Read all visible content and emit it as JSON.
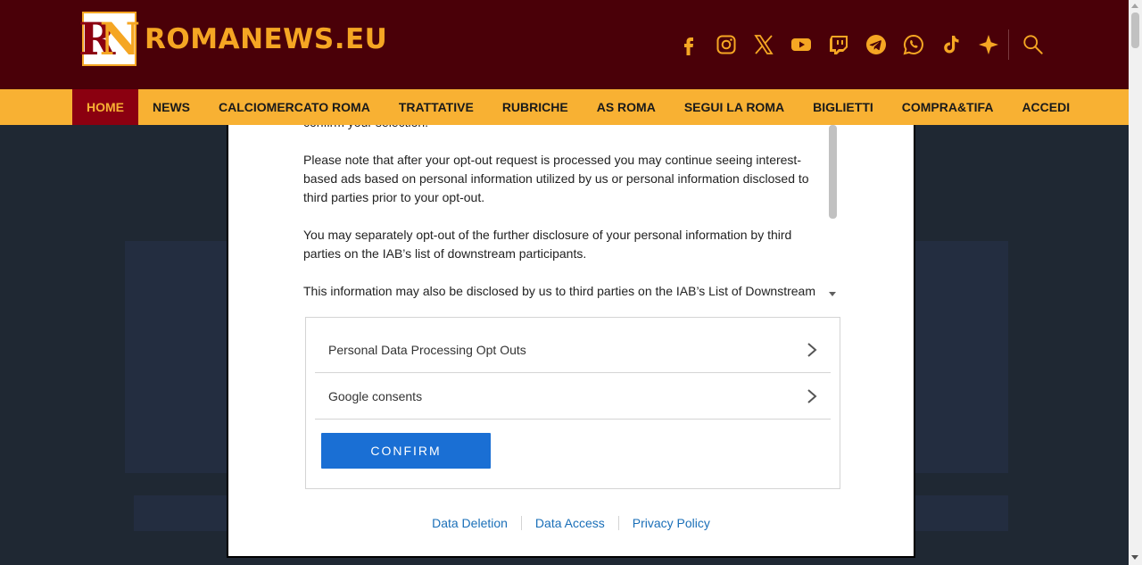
{
  "site": {
    "logo_letters": [
      "R",
      "N"
    ],
    "logo_text": "ROMANEWS.EU",
    "colors": {
      "header_bg": "#4a0008",
      "brand_gold": "#f5a623",
      "nav_bg": "#f8b133",
      "nav_active_bg": "#8b0010",
      "confirm_blue": "#1a6fd4",
      "link_blue": "#1a6fb8"
    }
  },
  "social_icons": [
    "facebook-icon",
    "instagram-icon",
    "x-icon",
    "youtube-icon",
    "twitch-icon",
    "telegram-icon",
    "whatsapp-icon",
    "tiktok-icon",
    "sparkle-icon",
    "search-icon"
  ],
  "nav": {
    "items": [
      {
        "label": "HOME",
        "active": true
      },
      {
        "label": "NEWS"
      },
      {
        "label": "CALCIOMERCATO ROMA"
      },
      {
        "label": "TRATTATIVE"
      },
      {
        "label": "RUBRICHE"
      },
      {
        "label": "AS ROMA"
      },
      {
        "label": "SEGUI LA ROMA"
      },
      {
        "label": "BIGLIETTI"
      },
      {
        "label": "COMPRA&TIFA"
      },
      {
        "label": "ACCEDI"
      }
    ]
  },
  "dialog": {
    "cut_text": "confirm your selection.",
    "paragraphs": [
      "Please note that after your opt-out request is processed you may continue seeing interest-based ads based on personal information utilized by us or personal information disclosed to third parties prior to your opt-out.",
      "You may separately opt-out of the further disclosure of your personal information by third parties on the IAB’s list of downstream participants.",
      "This information may also be disclosed by us to third parties on the IAB’s List of Downstream"
    ],
    "rows": [
      {
        "label": "Personal Data Processing Opt Outs"
      },
      {
        "label": "Google consents"
      }
    ],
    "confirm_label": "CONFIRM",
    "footer_links": [
      "Data Deletion",
      "Data Access",
      "Privacy Policy"
    ]
  }
}
